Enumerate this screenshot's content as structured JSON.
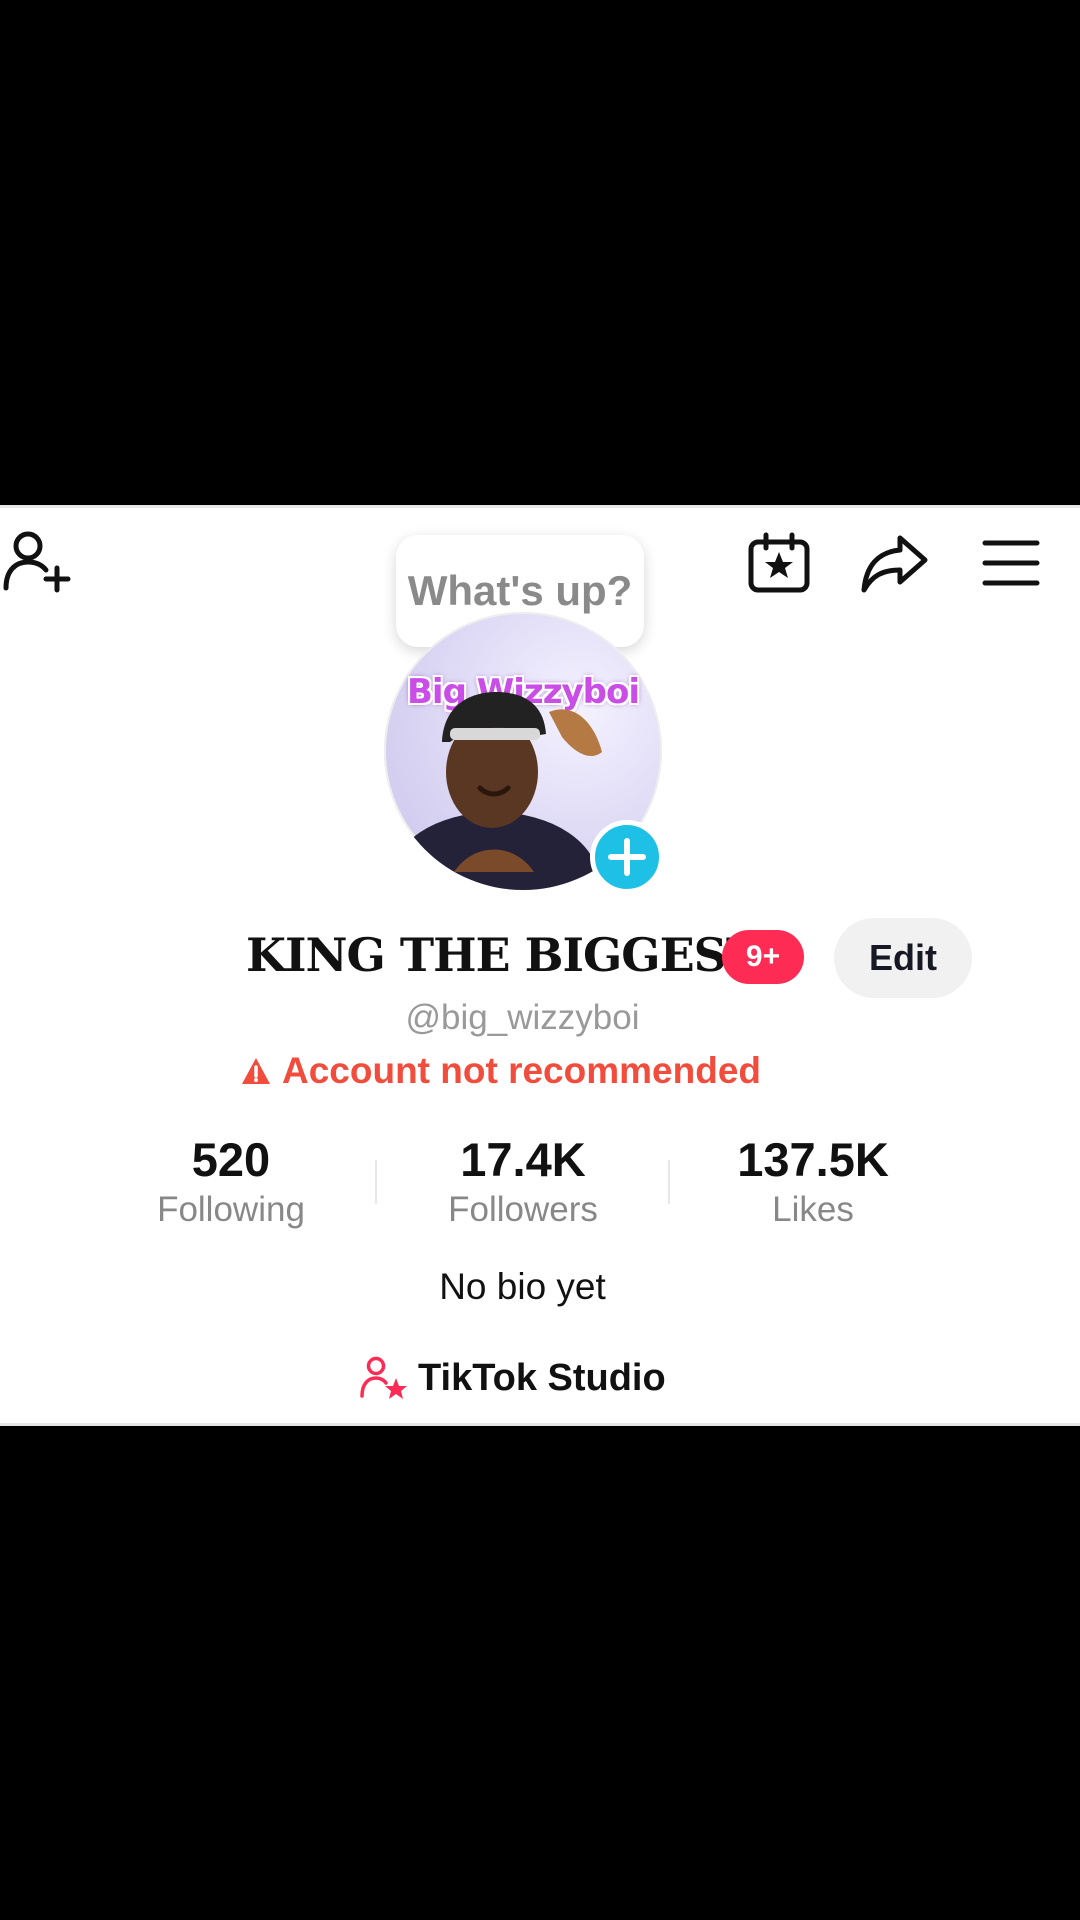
{
  "header": {
    "add_friend_icon": "person-plus-icon",
    "calendar_icon": "calendar-star-icon",
    "share_icon": "share-arrow-icon",
    "menu_icon": "hamburger-menu-icon"
  },
  "tooltip": {
    "text": "What's up?"
  },
  "avatar": {
    "label": "Big Wizzyboi",
    "add_icon": "plus-icon",
    "add_color": "#1fc0e5"
  },
  "profile": {
    "display_name": "KING THE BIGGEST",
    "badge": "9+",
    "badge_color": "#fe2c55",
    "edit_label": "Edit",
    "username": "@big_wizzyboi",
    "warning_icon": "warning-triangle-icon",
    "warning_text": "Account not recommended",
    "warning_color": "#f24c3d"
  },
  "stats": [
    {
      "value": "520",
      "label": "Following"
    },
    {
      "value": "17.4K",
      "label": "Followers"
    },
    {
      "value": "137.5K",
      "label": "Likes"
    }
  ],
  "bio": "No bio yet",
  "studio": {
    "icon": "person-star-icon",
    "label": "TikTok Studio"
  }
}
